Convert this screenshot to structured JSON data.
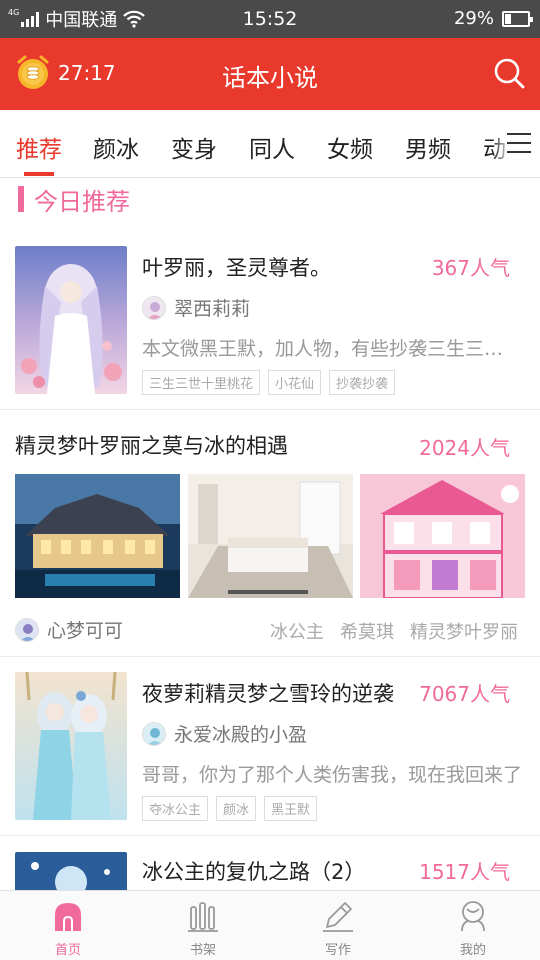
{
  "status_bar": {
    "network": "4G",
    "carrier": "中国联通",
    "time": "15:52",
    "battery": "29%",
    "battery_level": 0.29
  },
  "app_bar": {
    "timer": "27:17",
    "title": "话本小说",
    "timer_icon": "alarm-clock-coin-icon",
    "search_icon": "search-icon"
  },
  "tabs": [
    {
      "label": "推荐",
      "active": true
    },
    {
      "label": "颜冰"
    },
    {
      "label": "变身"
    },
    {
      "label": "同人"
    },
    {
      "label": "女频"
    },
    {
      "label": "男频"
    },
    {
      "label": "动"
    }
  ],
  "section": {
    "title": "今日推荐"
  },
  "books": [
    {
      "title": "叶罗丽，圣灵尊者。",
      "popularity": "367人气",
      "author": "翠西莉莉",
      "desc": "本文微黑王默，加人物，有些抄袭三生三世十里桃花",
      "tags": [
        "三生三世十里桃花",
        "小花仙",
        "抄袭抄袭"
      ]
    },
    {
      "title": "夜萝莉精灵梦之雪玲的逆袭",
      "popularity": "7067人气",
      "author": "永爱冰殿的小盈",
      "desc": "哥哥，你为了那个人类伤害我，现在我回来了",
      "tags": [
        "夺冰公主",
        "颜冰",
        "黑王默"
      ]
    },
    {
      "title": "冰公主的复仇之路（2）",
      "popularity": "1517人气"
    }
  ],
  "card2": {
    "title": "精灵梦叶罗丽之莫与冰的相遇",
    "popularity": "2024人气",
    "author": "心梦可可",
    "tags": [
      "冰公主",
      "希莫琪",
      "精灵梦叶罗丽"
    ]
  },
  "bottom_nav": [
    {
      "label": "首页",
      "icon": "home-icon",
      "active": true
    },
    {
      "label": "书架",
      "icon": "bookshelf-icon"
    },
    {
      "label": "写作",
      "icon": "pen-icon"
    },
    {
      "label": "我的",
      "icon": "profile-icon"
    }
  ],
  "colors": {
    "brand_red": "#e8392c",
    "accent_pink": "#f06a9b"
  }
}
